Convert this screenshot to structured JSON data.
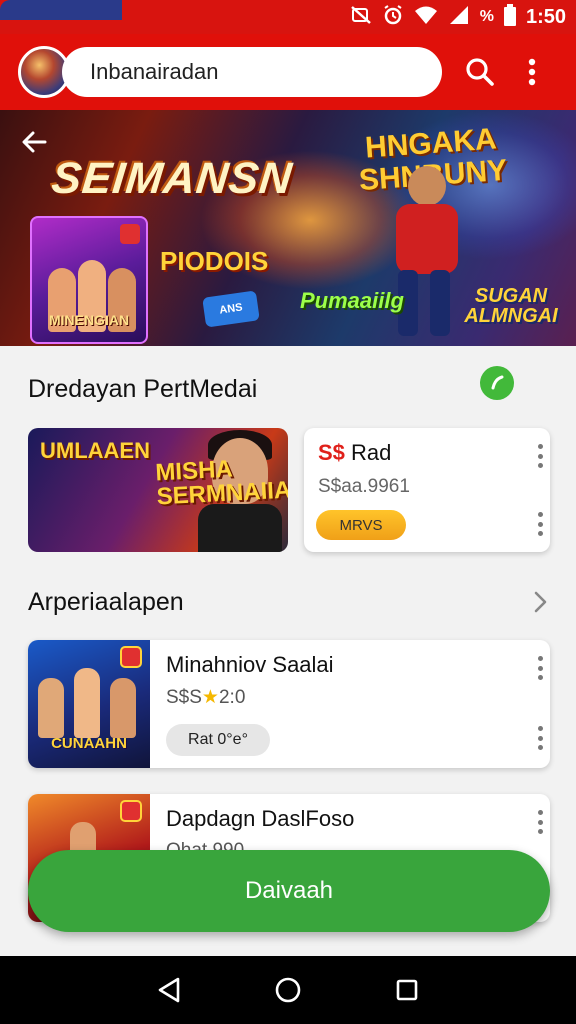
{
  "status_bar": {
    "time": "1:50",
    "battery": "%",
    "icons": [
      "mute-icon",
      "alarm-icon",
      "wifi-icon",
      "signal-icon",
      "battery-icon"
    ]
  },
  "app_bar": {
    "search_text": "Inbanairadan",
    "icons": [
      "avatar",
      "search-icon",
      "more-vert-icon"
    ]
  },
  "hero": {
    "title": "SEIMANSN",
    "title_right": "HNGAKA SHNBUNY",
    "card_caption": "MINENGIAN",
    "promo": "PIODOIS",
    "green_text": "Pumaaiilg",
    "right_caption": "SUGAN ALMNGAI",
    "tag": "ANS"
  },
  "section1": {
    "title": "Dredayan PertMedai",
    "banner_text_left": "UMLAAEN",
    "banner_text_right": "MISHA SERMNAIIA",
    "card": {
      "price_highlight": "S$",
      "price_rest": " Rad",
      "subtitle": "S$aa.9961",
      "pill": "MRVS"
    }
  },
  "section2": {
    "title": "Arperiaalapen",
    "items": [
      {
        "title": "Minahniov Saalai",
        "subtitle_prefix": "S$S",
        "star": "★",
        "subtitle_suffix": "2:0",
        "thumb_caption": "CUNAAHN",
        "pill": "Rat 0°e°"
      },
      {
        "title": "Dapdagn DaslFoso",
        "subtitle": "Ohat 990"
      }
    ]
  },
  "fab": {
    "label": "Daivaah"
  },
  "colors": {
    "primary_red": "#e0100a",
    "fab_green": "#39a53c",
    "accent_orange": "#f0a018",
    "price_red": "#e0201a"
  }
}
